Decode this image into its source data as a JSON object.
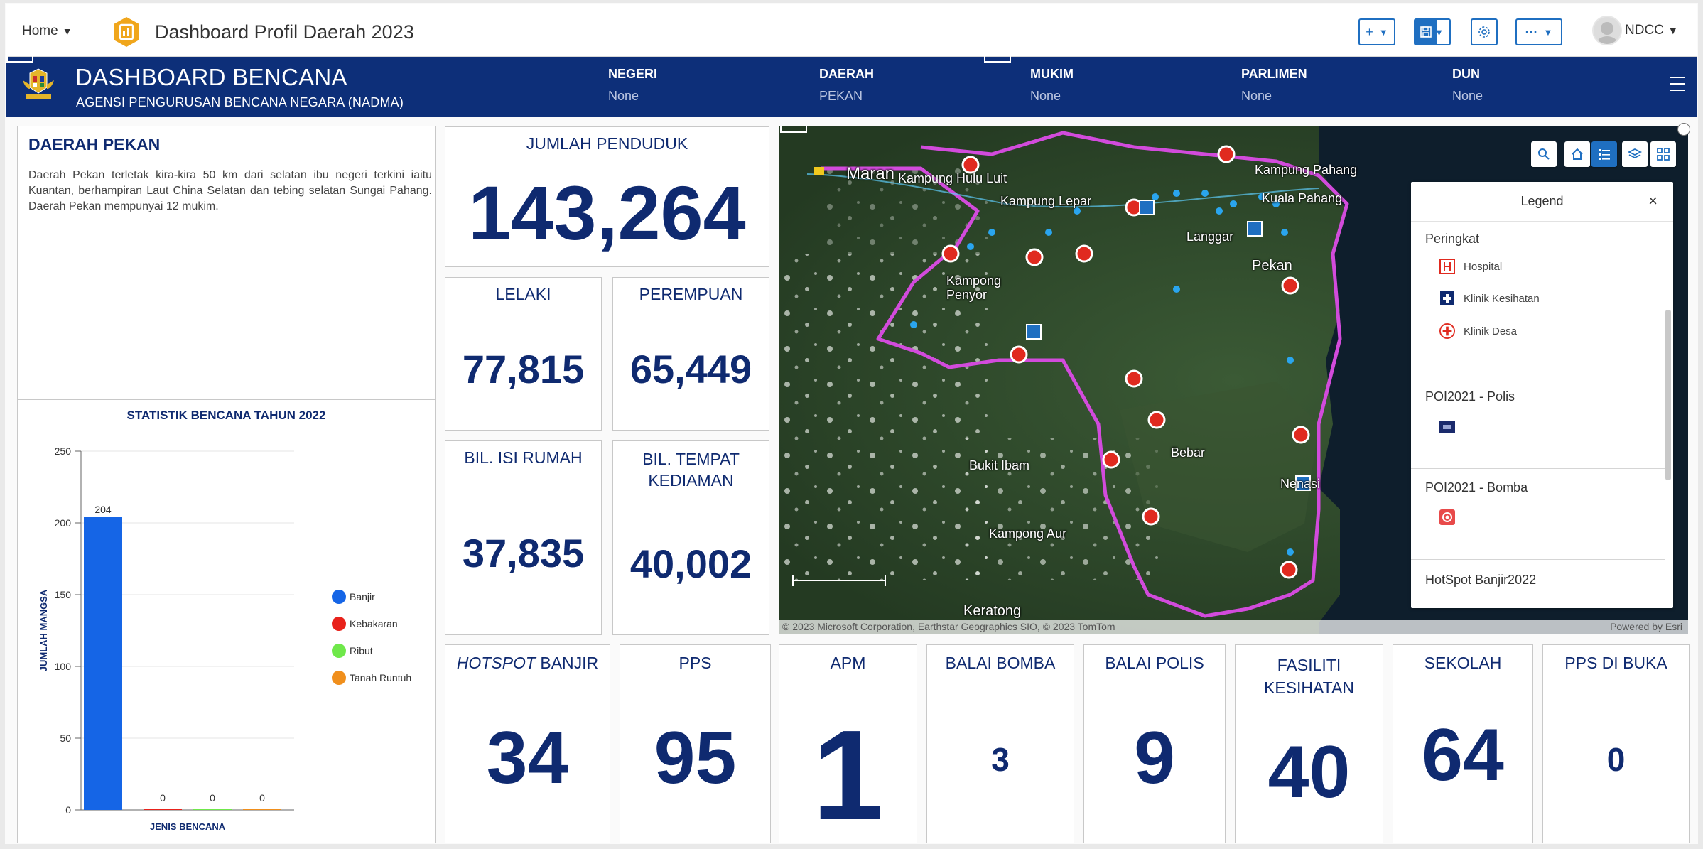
{
  "topbar": {
    "home_label": "Home",
    "app_title": "Dashboard Profil Daerah 2023",
    "add_label": "+",
    "more_label": "···",
    "user_name": "NDCC"
  },
  "header": {
    "title": "DASHBOARD BENCANA",
    "subtitle": "AGENSI PENGURUSAN BENCANA NEGARA (NADMA)",
    "selectors": [
      {
        "label": "NEGERI",
        "value": "None"
      },
      {
        "label": "DAERAH",
        "value": "PEKAN"
      },
      {
        "label": "MUKIM",
        "value": "None"
      },
      {
        "label": "PARLIMEN",
        "value": "None"
      },
      {
        "label": "DUN",
        "value": "None"
      }
    ]
  },
  "description": {
    "title": "DAERAH PEKAN",
    "text": "Daerah Pekan terletak kira-kira 50 km dari selatan ibu negeri terkini iaitu Kuantan, berhampiran Laut China Selatan dan tebing selatan Sungai Pahang. Daerah Pekan mempunyai 12 mukim."
  },
  "stats": {
    "jumlah_penduduk": {
      "label": "JUMLAH PENDUDUK",
      "value": "143,264"
    },
    "lelaki": {
      "label": "LELAKI",
      "value": "77,815"
    },
    "perempuan": {
      "label": "PEREMPUAN",
      "value": "65,449"
    },
    "isi_rumah": {
      "label": "BIL. ISI RUMAH",
      "value": "37,835"
    },
    "tempat_kediaman": {
      "label": "BIL. TEMPAT KEDIAMAN",
      "value": "40,002"
    },
    "hotspot_banjir": {
      "label_em": "HOTSPOT",
      "label_rest": " BANJIR",
      "value": "34"
    },
    "pps": {
      "label": "PPS",
      "value": "95"
    },
    "apm": {
      "label": "APM",
      "value": "1"
    },
    "balai_bomba": {
      "label": "BALAI BOMBA",
      "value": "3"
    },
    "balai_polis": {
      "label": "BALAI POLIS",
      "value": "9"
    },
    "fasiliti_kesihatan": {
      "label": "FASILITI KESIHATAN",
      "value": "40"
    },
    "sekolah": {
      "label": "SEKOLAH",
      "value": "64"
    },
    "pps_dibuka": {
      "label": "PPS DI BUKA",
      "value": "0"
    }
  },
  "chart_data": {
    "type": "bar",
    "title": "STATISTIK BENCANA TAHUN 2022",
    "xlabel": "JENIS BENCANA",
    "ylabel": "JUMLAH MANGSA",
    "ylim": [
      0,
      250
    ],
    "yticks": [
      0,
      50,
      100,
      150,
      200,
      250
    ],
    "categories": [
      "Banjir",
      "Kebakaran",
      "Ribut",
      "Tanah Runtuh"
    ],
    "values": [
      204,
      0,
      0,
      0
    ],
    "colors": [
      "#1565e6",
      "#e8221b",
      "#6fe84a",
      "#f08f1c"
    ],
    "legend_position": "right",
    "grid": true
  },
  "map": {
    "towns": [
      "Maran",
      "Kampung Hulu Luit",
      "Kampung Lepar",
      "Kampung Pahang",
      "Kuala Pahang",
      "Langgar",
      "Pekan",
      "Kampong Penyor",
      "Bebar",
      "Bukit Ibam",
      "Nenasi",
      "Kampong Aur",
      "Keratong"
    ],
    "attribution": "© 2023 Microsoft Corporation, Earthstar Geographics SIO, © 2023 TomTom",
    "powered_by": "Powered by Esri",
    "legend": {
      "title": "Legend",
      "close": "×",
      "sec1": "Peringkat",
      "items": [
        "Hospital",
        "Klinik Kesihatan",
        "Klinik Desa"
      ],
      "sec2": "POI2021 - Polis",
      "sec3": "POI2021 - Bomba",
      "sec4": "HotSpot Banjir2022"
    },
    "colors": {
      "boundary": "#d24bdc",
      "clinic_desa": "#e02a1f",
      "navy": "#0f2a70",
      "accent": "#1f6fc1"
    }
  }
}
